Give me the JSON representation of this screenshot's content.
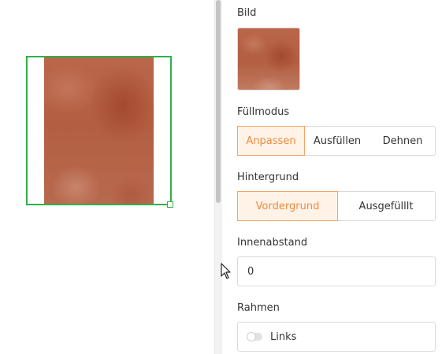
{
  "colors": {
    "selection": "#2fb14c",
    "accent": "#f08a3c",
    "accent_bg": "#fff3e8",
    "image_tone": "#b35e42"
  },
  "icons": {
    "cursor": "mouse-pointer-icon"
  },
  "panel": {
    "image_section": {
      "label": "Bild"
    },
    "fill_mode": {
      "label": "Füllmodus",
      "options": [
        "Anpassen",
        "Ausfüllen",
        "Dehnen"
      ],
      "selected": "Anpassen"
    },
    "background": {
      "label": "Hintergrund",
      "options": [
        "Vordergrund",
        "Ausgefülllt"
      ],
      "selected": "Vordergrund"
    },
    "padding": {
      "label": "Innenabstand",
      "value": "0"
    },
    "border": {
      "label": "Rahmen",
      "toggle_label": "Links",
      "toggle_on": false
    }
  }
}
